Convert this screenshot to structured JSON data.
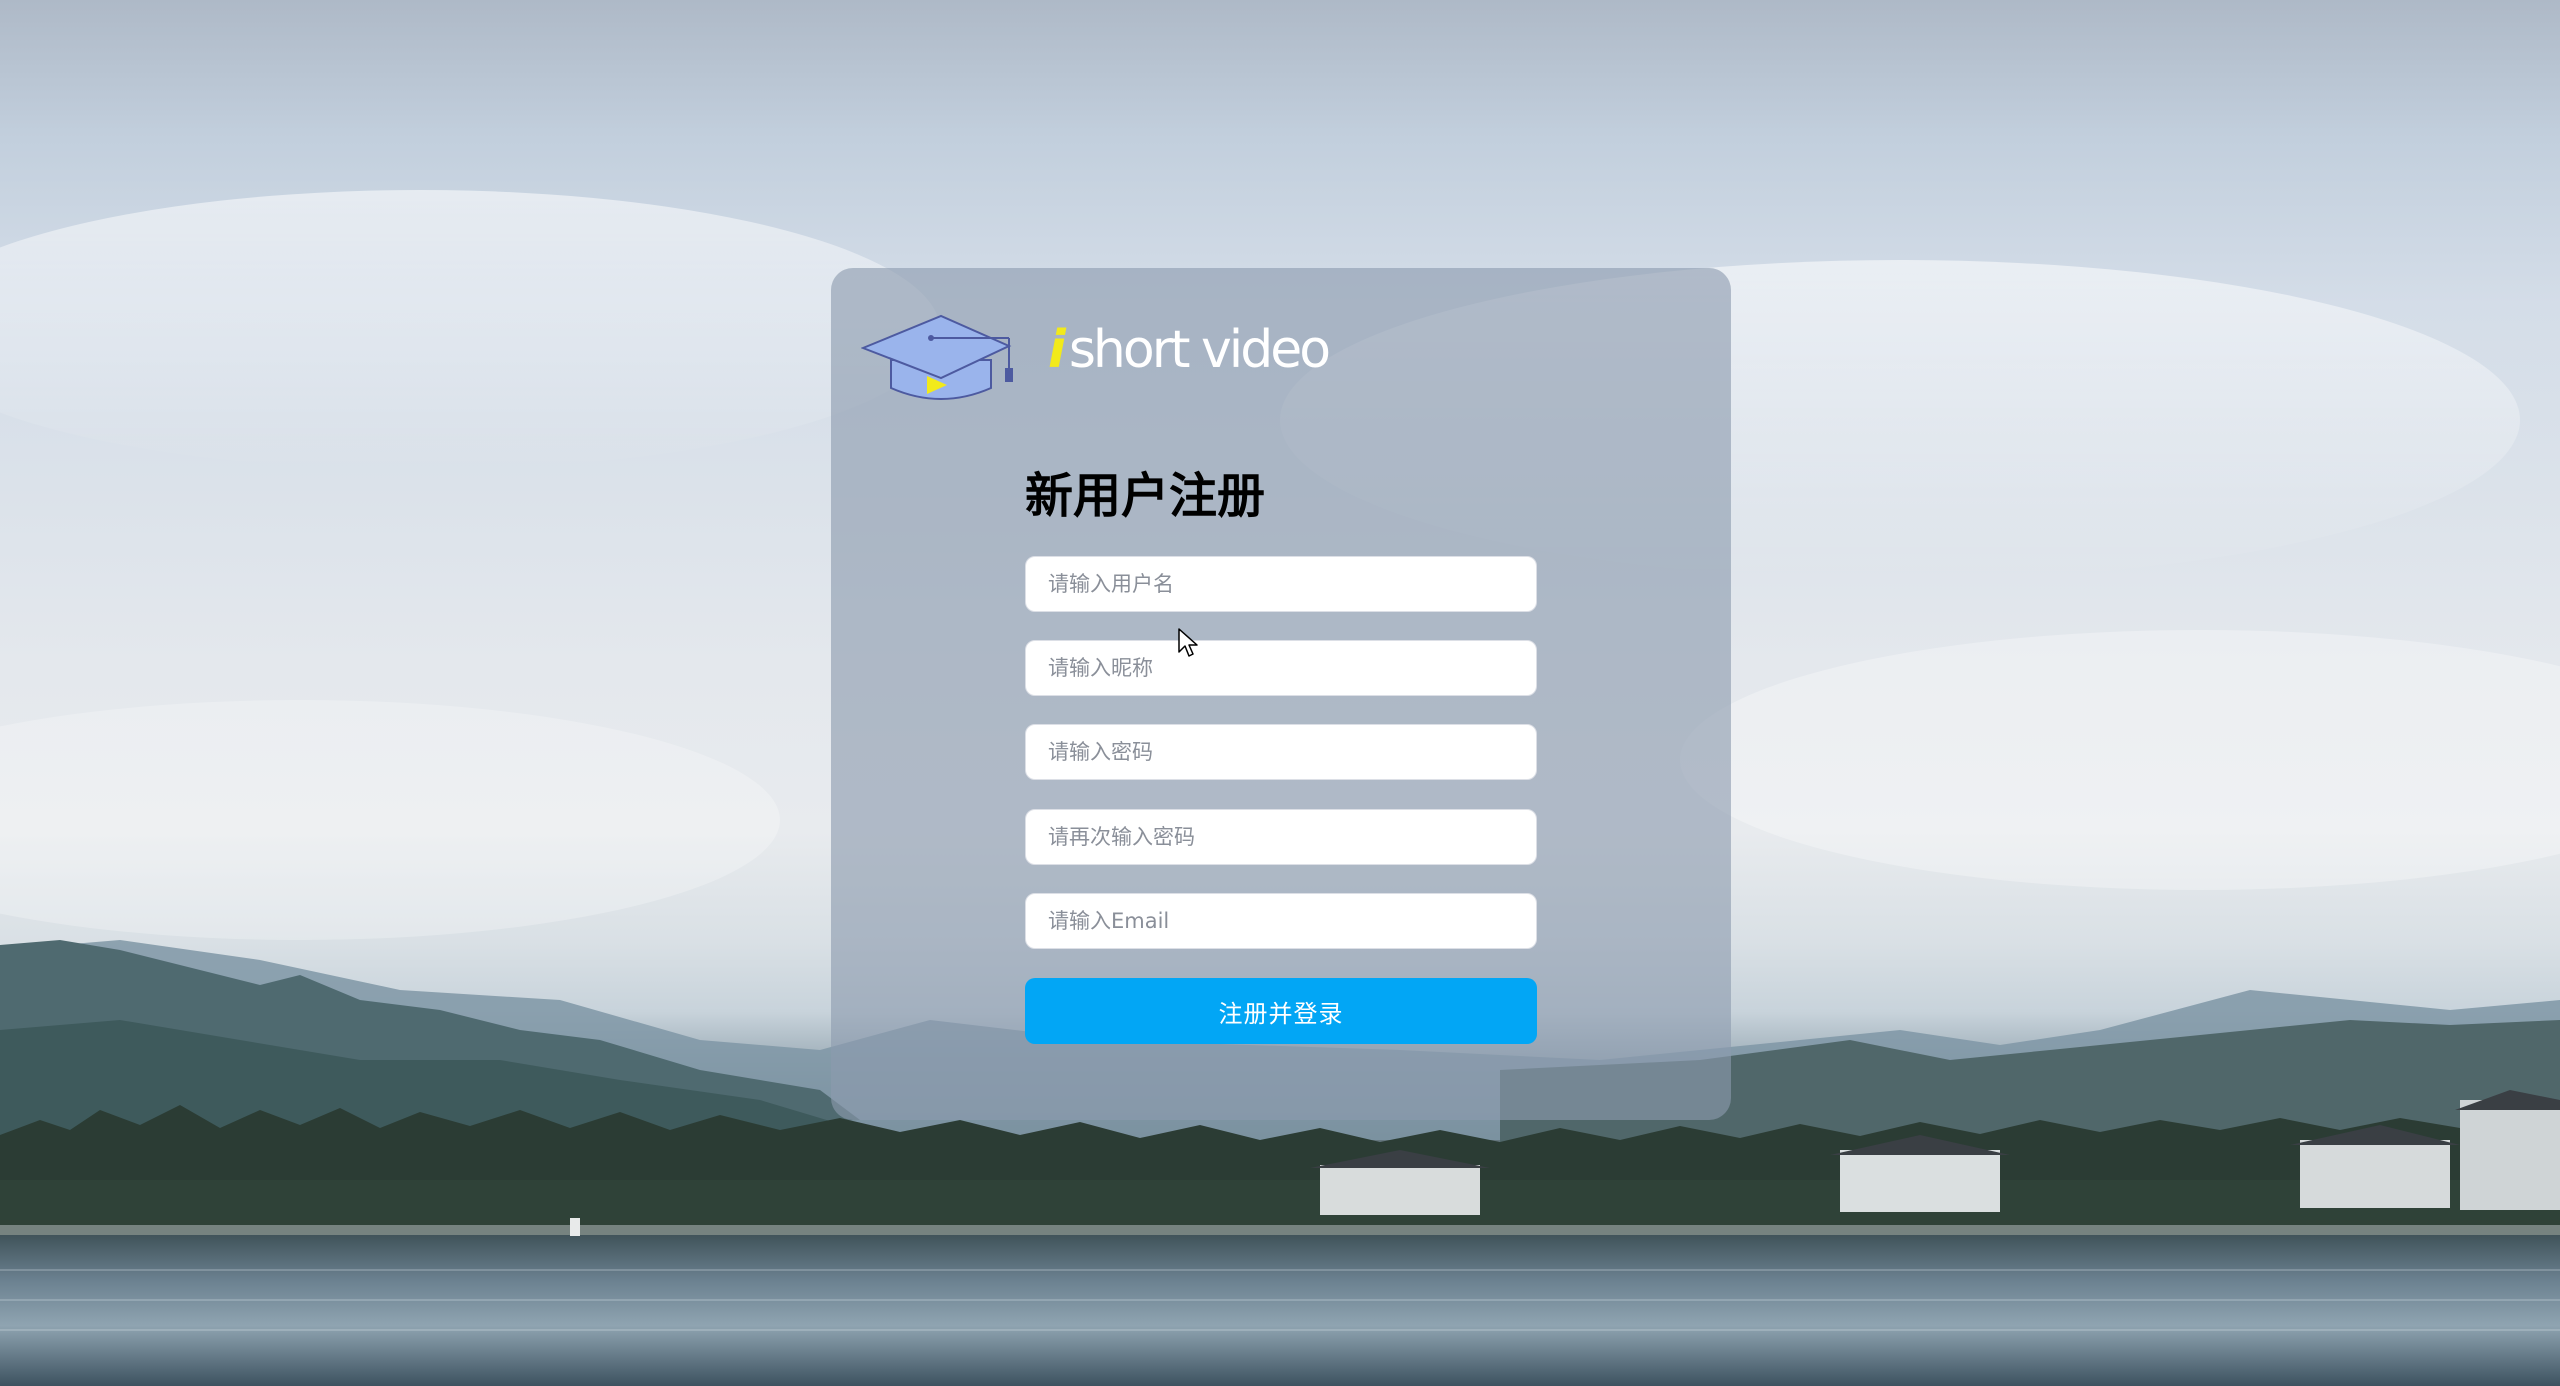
{
  "brand": {
    "logo_i": "i",
    "logo_text": "short video"
  },
  "form": {
    "title": "新用户注册",
    "username_placeholder": "请输入用户名",
    "nickname_placeholder": "请输入昵称",
    "password_placeholder": "请输入密码",
    "password_confirm_placeholder": "请再次输入密码",
    "email_placeholder": "请输入Email",
    "submit_label": "注册并登录"
  },
  "colors": {
    "accent": "#02a6f5",
    "logo_i": "#f2ea1a",
    "cap": "#9ab4ec",
    "play": "#f2ea1a"
  },
  "icons": {
    "logo": "graduation-cap-play-icon",
    "cursor": "mouse-pointer-icon"
  }
}
